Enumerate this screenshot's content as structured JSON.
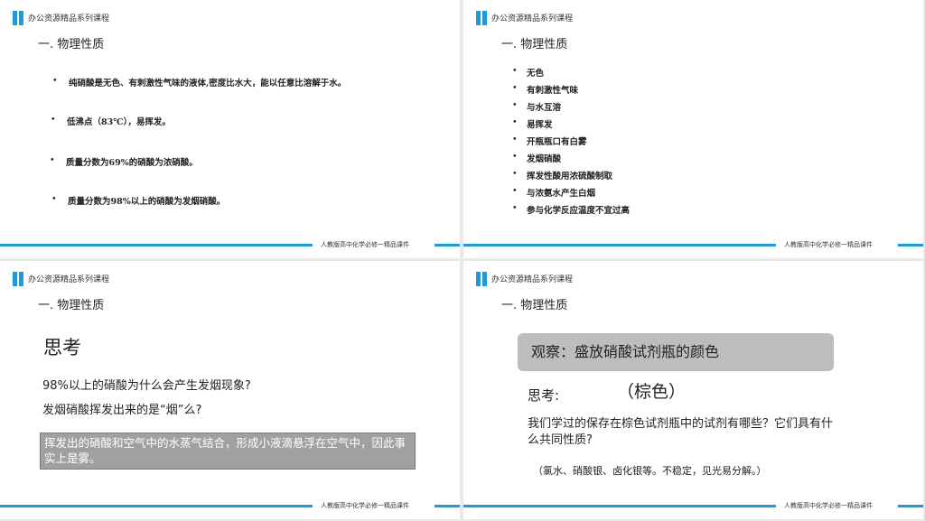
{
  "brand_color": "#1e9ad6",
  "slides": [
    {
      "brand": "办公资源精品系列课程",
      "heading": "一. 物理性质",
      "bullets": [
        "纯硝酸是无色、有刺激性气味的液体,密度比水大，能以任意比溶解于水。",
        "低沸点（83℃），易挥发。",
        "质量分数为69%的硝酸为浓硝酸。",
        "质量分数为98%以上的硝酸为发烟硝酸。"
      ],
      "footer": "人教版高中化学必修一精品课件"
    },
    {
      "brand": "办公资源精品系列课程",
      "heading": "一. 物理性质",
      "bullets": [
        "无色",
        "有刺激性气味",
        "与水互溶",
        "易挥发",
        "开瓶瓶口有白雾",
        "发烟硝酸",
        "挥发性酸用浓硫酸制取",
        "与浓氨水产生白烟",
        "参与化学反应温度不宜过高"
      ],
      "footer": "人教版高中化学必修一精品课件"
    },
    {
      "brand": "办公资源精品系列课程",
      "heading": "一. 物理性质",
      "title": "思考",
      "q1": "98%以上的硝酸为什么会产生发烟现象?",
      "q2": "发烟硝酸挥发出来的是“烟”么?",
      "answer": "挥发出的硝酸和空气中的水蒸气结合，形成小液滴悬浮在空气中，因此事实上是雾。",
      "footer": "人教版高中化学必修一精品课件"
    },
    {
      "brand": "办公资源精品系列课程",
      "heading": "一. 物理性质",
      "observe": "观察：盛放硝酸试剂瓶的颜色",
      "think": "思考:",
      "brown": "（棕色）",
      "question": "我们学过的保存在棕色试剂瓶中的试剂有哪些？它们具有什么共同性质?",
      "answer": "（氯水、硝酸银、卤化银等。不稳定，见光易分解。）",
      "footer": "人教版高中化学必修一精品课件"
    }
  ]
}
